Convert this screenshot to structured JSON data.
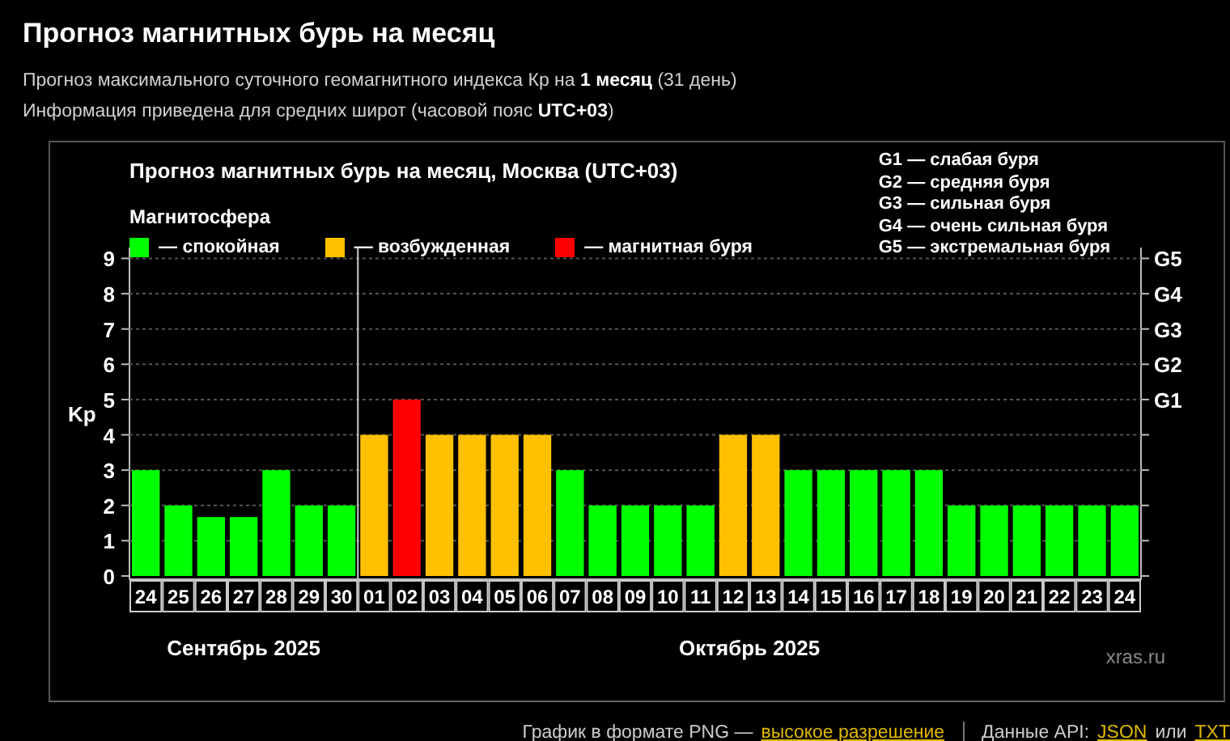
{
  "title": "Прогноз магнитных бурь на месяц",
  "subtitle_lines": [
    "Прогноз максимального суточного геомагнитного индекса Кр на **1 месяц** (31 день)",
    "Информация приведена для средних широт (часовой пояс **UTC+03**)"
  ],
  "chart": {
    "title": "Прогноз магнитных бурь на месяц, Москва (UTC+03)",
    "legend_title": "Магнитосфера",
    "legend": [
      {
        "label": "— спокойная",
        "color": "#00ff00"
      },
      {
        "label": "— возбужденная",
        "color": "#ffc000"
      },
      {
        "label": "— магнитная буря",
        "color": "#ff0000"
      }
    ],
    "storm_levels": [
      "G1 — слабая буря",
      "G2 — средняя буря",
      "G3 — сильная буря",
      "G4 — очень сильная буря",
      "G5 — экстремальная буря"
    ],
    "g_axis_labels": [
      "G5",
      "G4",
      "G3",
      "G2",
      "G1"
    ],
    "months": [
      "Сентябрь 2025",
      "Октябрь 2025"
    ],
    "credit": "xras.ru",
    "chart_data": {
      "type": "bar",
      "ylabel": "Kp",
      "categories": [
        "24",
        "25",
        "26",
        "27",
        "28",
        "29",
        "30",
        "01",
        "02",
        "03",
        "04",
        "05",
        "06",
        "07",
        "08",
        "09",
        "10",
        "11",
        "12",
        "13",
        "14",
        "15",
        "16",
        "17",
        "18",
        "19",
        "20",
        "21",
        "22",
        "23",
        "24"
      ],
      "values": [
        3,
        2,
        1.67,
        1.67,
        3,
        2,
        2,
        4,
        5,
        4,
        4,
        4,
        4,
        3,
        2,
        2,
        2,
        2,
        4,
        4,
        3,
        3,
        3,
        3,
        3,
        2,
        2,
        2,
        2,
        2,
        2
      ],
      "ylim": [
        0,
        9.4
      ],
      "yticks": [
        0,
        1,
        2,
        3,
        4,
        5,
        6,
        7,
        8,
        9
      ],
      "grid": true
    }
  },
  "footer": {
    "text": "График в формате PNG —",
    "link": "высокое разрешение",
    "api_label": "Данные API:",
    "api_links": [
      "JSON",
      "TXT"
    ],
    "api_joiner": "или"
  }
}
